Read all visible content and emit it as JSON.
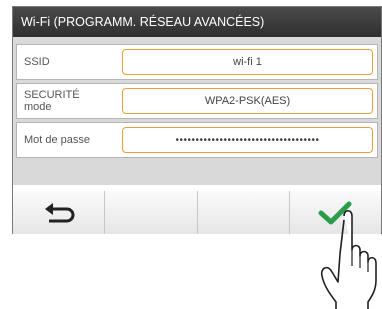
{
  "title": "Wi-Fi (PROGRAMM. RÉSEAU AVANCÉES)",
  "rows": [
    {
      "label": "SSID",
      "value": "wi-fi 1"
    },
    {
      "label": "SECURITÉ\nmode",
      "value": "WPA2-PSK(AES)"
    },
    {
      "label": "Mot de passe",
      "value": "••••••••••••••••••••••••••••••••••••"
    }
  ],
  "toolbar": {
    "buttons": [
      "back-arrow-icon",
      "",
      "",
      "checkmark-icon"
    ]
  },
  "colors": {
    "field_border": "#e8a13a",
    "check": "#2a9d4a",
    "titlebar": "#3a3a3a"
  }
}
